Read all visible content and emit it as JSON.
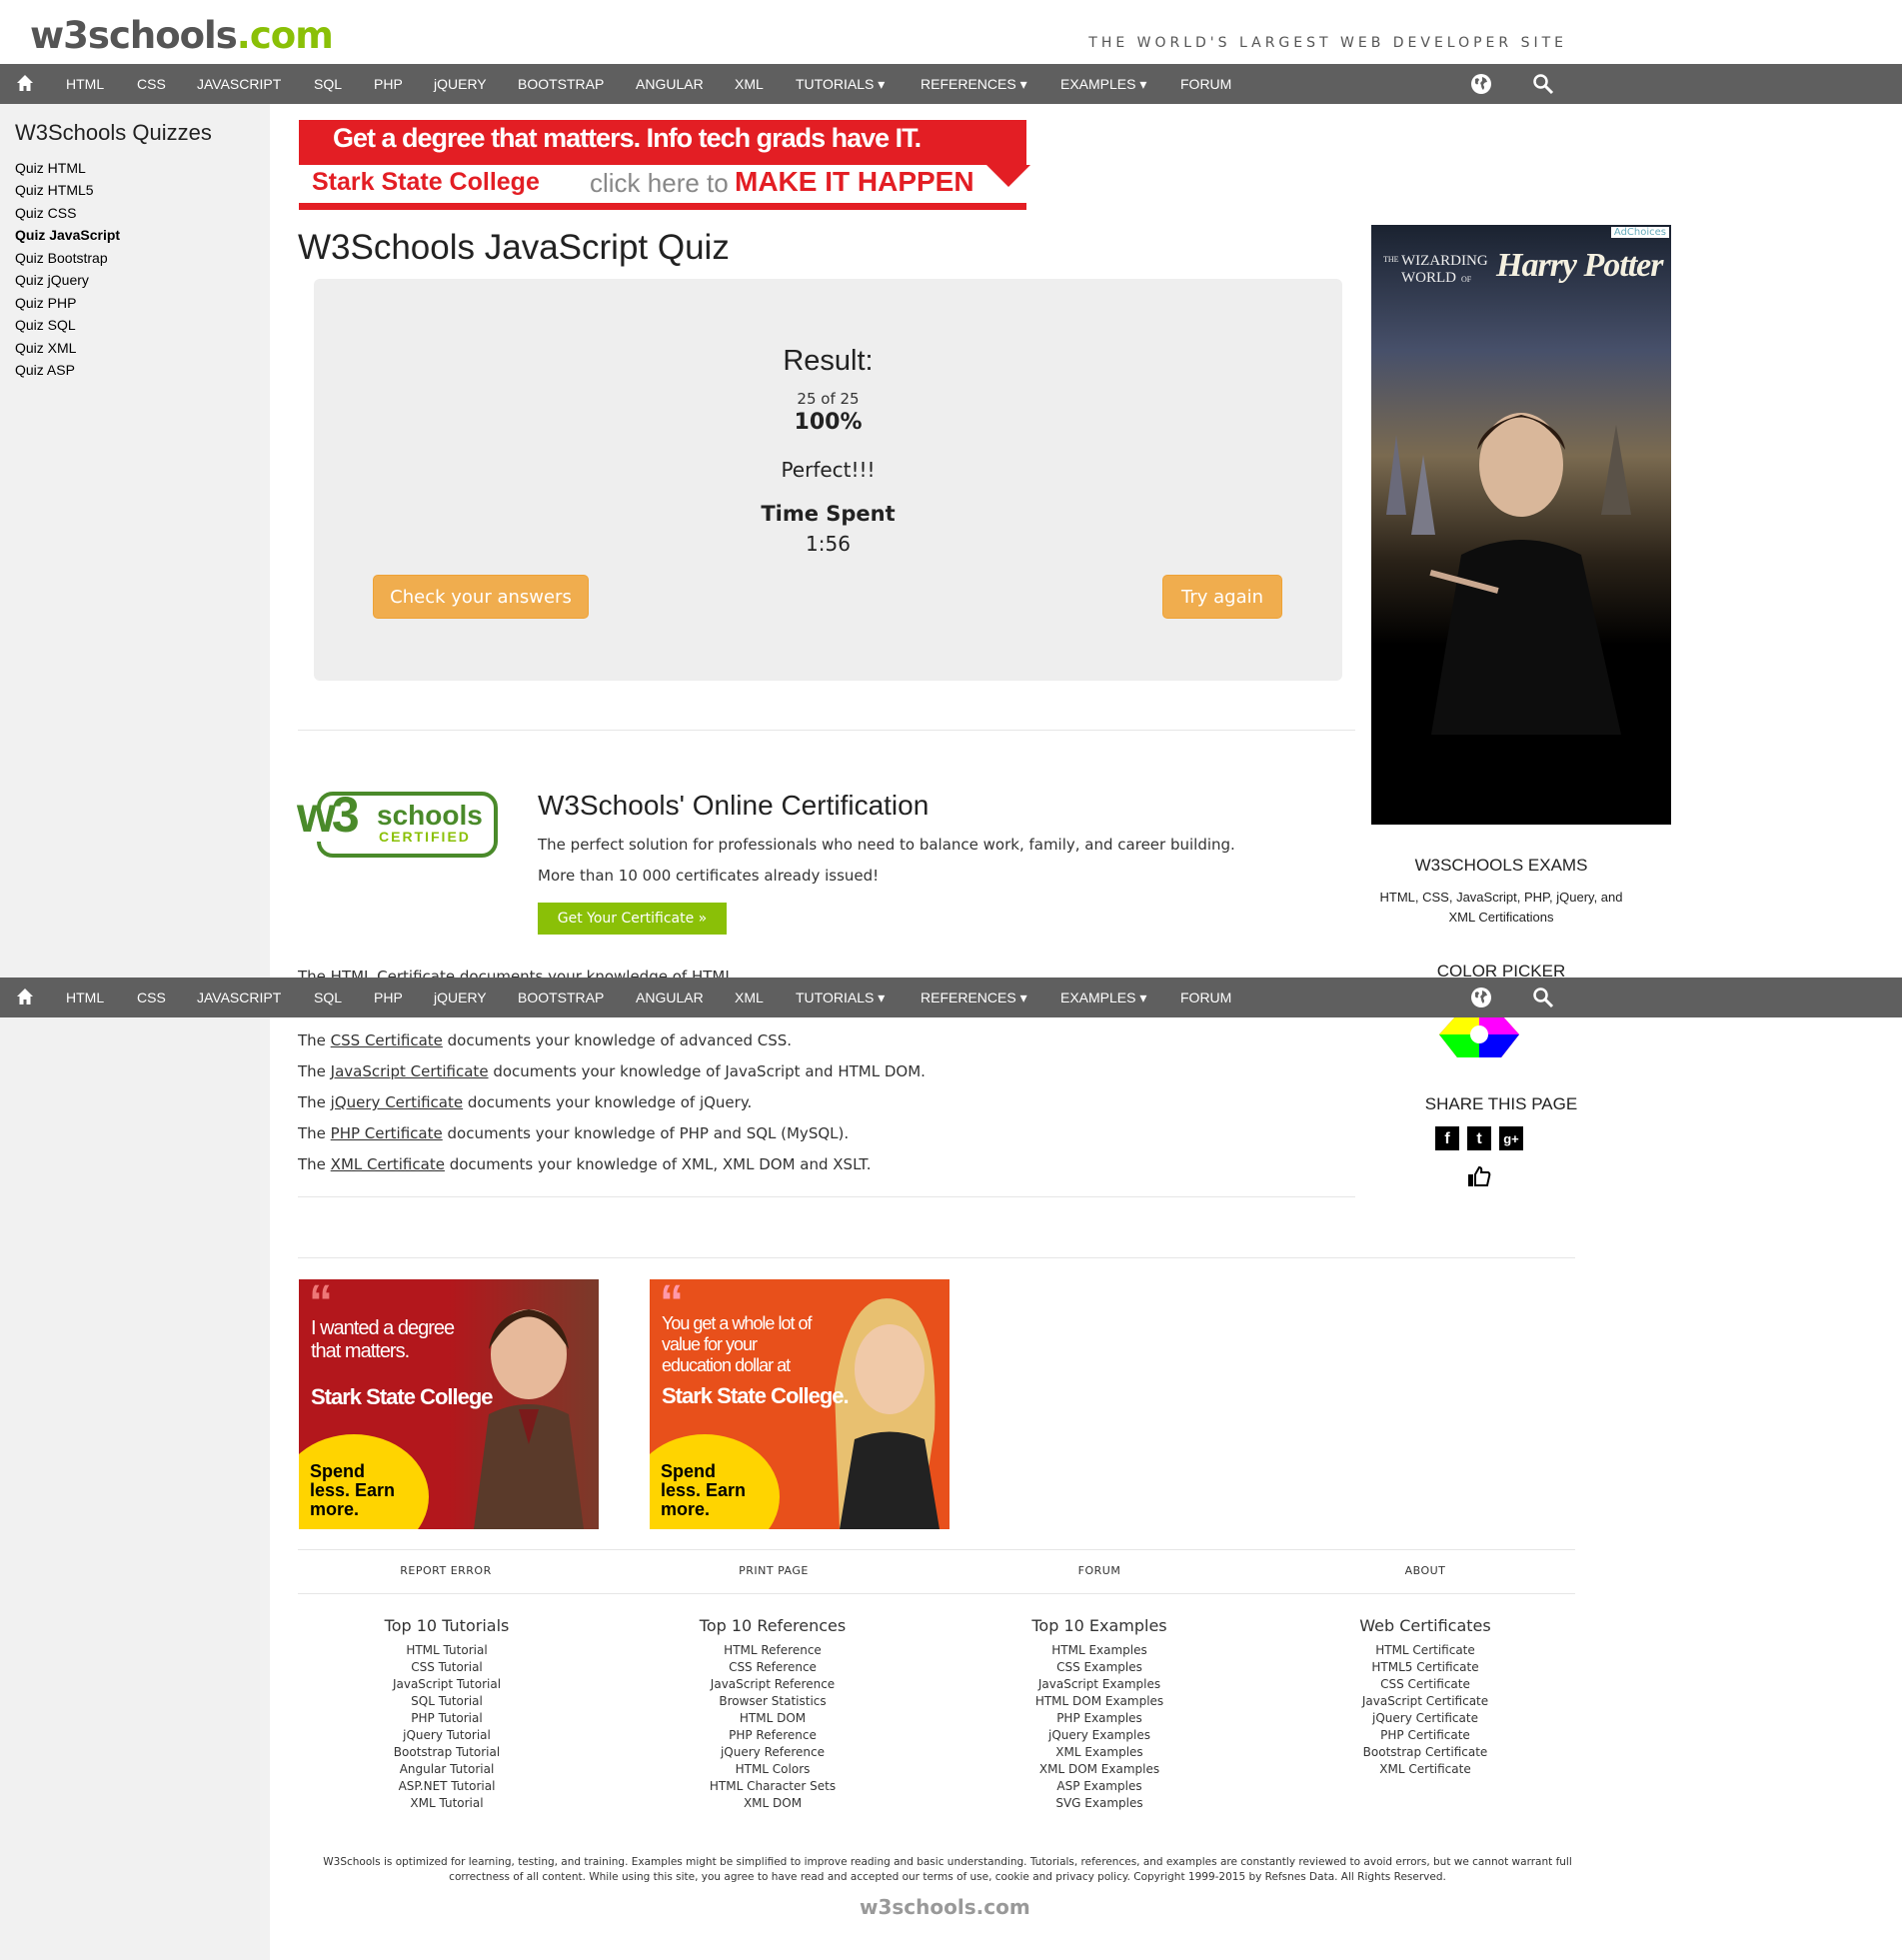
{
  "header": {
    "logo_main": "w3schools",
    "logo_domain": ".com",
    "tagline": "THE WORLD'S LARGEST WEB DEVELOPER SITE"
  },
  "nav": {
    "items": [
      "HTML",
      "CSS",
      "JAVASCRIPT",
      "SQL",
      "PHP",
      "jQUERY",
      "BOOTSTRAP",
      "ANGULAR",
      "XML",
      "TUTORIALS ▾",
      "REFERENCES ▾",
      "EXAMPLES ▾",
      "FORUM"
    ],
    "icons": [
      "home-icon",
      "globe-icon",
      "search-icon"
    ],
    "bg_color": "#5f5f5f"
  },
  "sidebar": {
    "title": "W3Schools Quizzes",
    "items": [
      "Quiz HTML",
      "Quiz HTML5",
      "Quiz CSS",
      "Quiz JavaScript",
      "Quiz Bootstrap",
      "Quiz jQuery",
      "Quiz PHP",
      "Quiz SQL",
      "Quiz XML",
      "Quiz ASP"
    ],
    "active": "Quiz JavaScript"
  },
  "top_ad": {
    "line1": "Get a degree that matters.  Info tech grads have IT.",
    "college": "Stark State College",
    "click": "click here to",
    "cta": "MAKE IT HAPPEN"
  },
  "main": {
    "title": "W3Schools JavaScript Quiz",
    "result": {
      "title": "Result:",
      "score": "25 of 25",
      "percent": "100%",
      "message": "Perfect!!!",
      "time_label": "Time Spent",
      "time": "1:56",
      "check_button": "Check your answers",
      "again_button": "Try again"
    },
    "certification": {
      "logo_w3": "w3",
      "logo_schools": "schools",
      "logo_certified": "CERTIFIED",
      "title": "W3Schools' Online Certification",
      "desc": "The perfect solution for professionals who need to balance work, family, and career building.",
      "count": "More than 10 000 certificates already issued!",
      "button": "Get Your Certificate »",
      "lines": [
        {
          "pre": "The ",
          "link": "HTML Certificate",
          "post": " documents your knowledge of HTML."
        },
        {
          "pre": "The ",
          "link": "CSS Certificate",
          "post": " documents your knowledge of advanced CSS."
        },
        {
          "pre": "The ",
          "link": "JavaScript Certificate",
          "post": " documents your knowledge of JavaScript and HTML DOM."
        },
        {
          "pre": "The ",
          "link": "jQuery Certificate",
          "post": " documents your knowledge of jQuery."
        },
        {
          "pre": "The ",
          "link": "PHP Certificate",
          "post": " documents your knowledge of PHP and SQL (MySQL)."
        },
        {
          "pre": "The ",
          "link": "XML Certificate",
          "post": " documents your knowledge of XML, XML DOM and XSLT."
        }
      ]
    }
  },
  "right": {
    "ad_choices": "AdChoices",
    "hp_the": "THE",
    "hp_wizarding": "WIZARDING",
    "hp_world": "WORLD",
    "hp_of": "OF",
    "hp_title": "Harry Potter",
    "exams_title": "W3SCHOOLS EXAMS",
    "exams_text": "HTML, CSS, JavaScript, PHP, jQuery, and XML Certifications",
    "picker_title": "COLOR PICKER",
    "share_title": "SHARE THIS PAGE",
    "share_icons": [
      "facebook-icon",
      "twitter-icon",
      "google-plus-icon",
      "like-icon"
    ]
  },
  "bottom_ads": [
    {
      "quote": "I wanted a degree that matters.",
      "brand": "Stark State College",
      "sticker": "Spend less. Earn more.",
      "bg": "#b3171c"
    },
    {
      "quote": "You get a whole lot of value for your education dollar at",
      "brand": "Stark State College.",
      "sticker": "Spend less. Earn more.",
      "bg": "#e8501b"
    }
  ],
  "footer": {
    "links": [
      "REPORT ERROR",
      "PRINT PAGE",
      "FORUM",
      "ABOUT"
    ],
    "columns": [
      {
        "title": "Top 10 Tutorials",
        "items": [
          "HTML Tutorial",
          "CSS Tutorial",
          "JavaScript Tutorial",
          "SQL Tutorial",
          "PHP Tutorial",
          "jQuery Tutorial",
          "Bootstrap Tutorial",
          "Angular Tutorial",
          "ASP.NET Tutorial",
          "XML Tutorial"
        ]
      },
      {
        "title": "Top 10 References",
        "items": [
          "HTML Reference",
          "CSS Reference",
          "JavaScript Reference",
          "Browser Statistics",
          "HTML DOM",
          "PHP Reference",
          "jQuery Reference",
          "HTML Colors",
          "HTML Character Sets",
          "XML DOM"
        ]
      },
      {
        "title": "Top 10 Examples",
        "items": [
          "HTML Examples",
          "CSS Examples",
          "JavaScript Examples",
          "HTML DOM Examples",
          "PHP Examples",
          "jQuery Examples",
          "XML Examples",
          "XML DOM Examples",
          "ASP Examples",
          "SVG Examples"
        ]
      },
      {
        "title": "Web Certificates",
        "items": [
          "HTML Certificate",
          "HTML5 Certificate",
          "CSS Certificate",
          "JavaScript Certificate",
          "jQuery Certificate",
          "PHP Certificate",
          "Bootstrap Certificate",
          "XML Certificate"
        ]
      }
    ],
    "disclaimer": "W3Schools is optimized for learning, testing, and training. Examples might be simplified to improve reading and basic understanding. Tutorials, references, and examples are constantly reviewed to avoid errors, but we cannot warrant full correctness of all content. While using this site, you agree to have read and accepted our terms of use, cookie and privacy policy. Copyright 1999-2015 by Refsnes Data. All Rights Reserved.",
    "logo": "w3schools.com"
  }
}
